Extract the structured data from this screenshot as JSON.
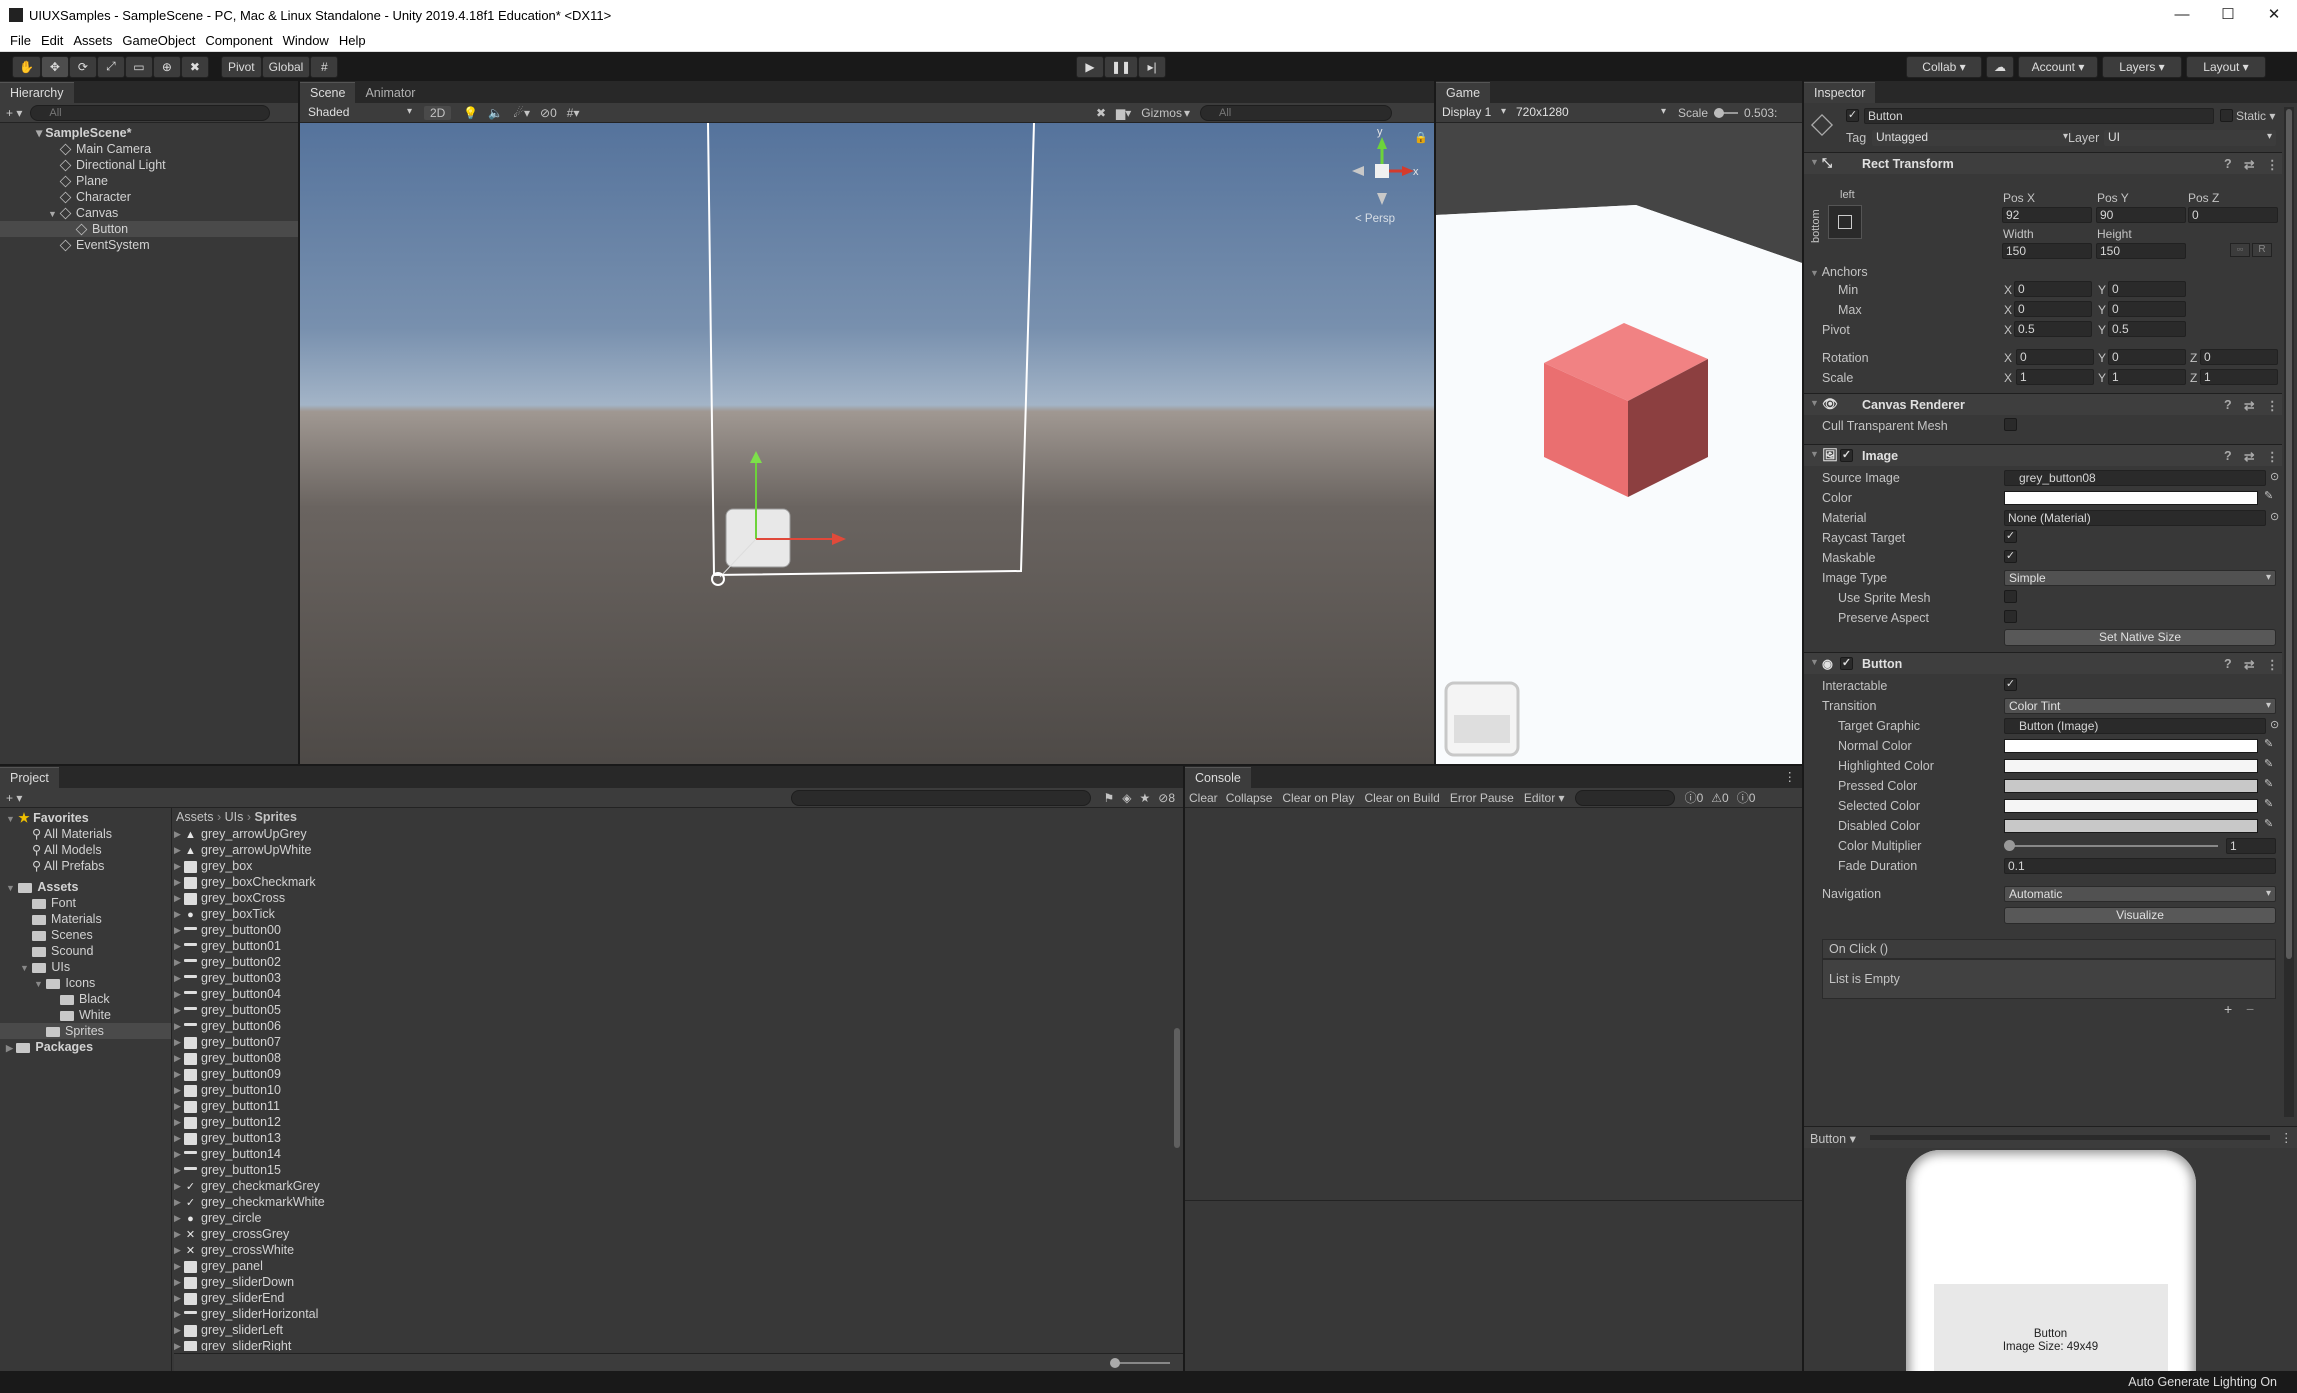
{
  "window": {
    "title": "UIUXSamples - SampleScene - PC, Mac & Linux Standalone - Unity 2019.4.18f1 Education* <DX11>"
  },
  "menu": [
    "File",
    "Edit",
    "Assets",
    "GameObject",
    "Component",
    "Window",
    "Help"
  ],
  "toolbar": {
    "pivot": "Pivot",
    "global": "Global",
    "collab": "Collab",
    "account": "Account",
    "layers": "Layers",
    "layout": "Layout"
  },
  "hierarchy": {
    "tab": "Hierarchy",
    "search_placeholder": "All",
    "items": [
      {
        "label": "SampleScene*",
        "depth": 0
      },
      {
        "label": "Main Camera",
        "depth": 1
      },
      {
        "label": "Directional Light",
        "depth": 1
      },
      {
        "label": "Plane",
        "depth": 1
      },
      {
        "label": "Character",
        "depth": 1
      },
      {
        "label": "Canvas",
        "depth": 1
      },
      {
        "label": "Button",
        "depth": 2
      },
      {
        "label": "EventSystem",
        "depth": 1
      }
    ]
  },
  "scene": {
    "tabs": [
      "Scene",
      "Animator"
    ],
    "shading": "Shaded",
    "mode2d": "2D",
    "hidden_count": "0",
    "gizmos": "Gizmos",
    "search_placeholder": "All",
    "persp": "Persp",
    "axes": {
      "y": "y",
      "x": "x"
    }
  },
  "game": {
    "tab": "Game",
    "display": "Display 1",
    "resolution": "720x1280",
    "scale_label": "Scale",
    "scale_value": "0.503:"
  },
  "inspector": {
    "tab": "Inspector",
    "object_name": "Button",
    "static_label": "Static",
    "tag_label": "Tag",
    "tag_value": "Untagged",
    "layer_label": "Layer",
    "layer_value": "UI",
    "rect": {
      "title": "Rect Transform",
      "anchor_h": "left",
      "anchor_v": "bottom",
      "posx_label": "Pos X",
      "posy_label": "Pos Y",
      "posz_label": "Pos Z",
      "posx": "92",
      "posy": "90",
      "posz": "0",
      "width_label": "Width",
      "height_label": "Height",
      "width": "150",
      "height": "150",
      "r_label": "R",
      "anchors_label": "Anchors",
      "min_label": "Min",
      "max_label": "Max",
      "pivot_label": "Pivot",
      "min_x": "0",
      "min_y": "0",
      "max_x": "0",
      "max_y": "0",
      "pivot_x": "0.5",
      "pivot_y": "0.5",
      "rotation_label": "Rotation",
      "rot_x": "0",
      "rot_y": "0",
      "rot_z": "0",
      "scale_label": "Scale",
      "scale_x": "1",
      "scale_y": "1",
      "scale_z": "1"
    },
    "canvas_renderer": {
      "title": "Canvas Renderer",
      "cull_label": "Cull Transparent Mesh"
    },
    "image": {
      "title": "Image",
      "source_label": "Source Image",
      "source_value": "grey_button08",
      "color_label": "Color",
      "material_label": "Material",
      "material_value": "None (Material)",
      "raycast_label": "Raycast Target",
      "maskable_label": "Maskable",
      "type_label": "Image Type",
      "type_value": "Simple",
      "sprite_mesh_label": "Use Sprite Mesh",
      "preserve_label": "Preserve Aspect",
      "native_btn": "Set Native Size"
    },
    "button": {
      "title": "Button",
      "interactable_label": "Interactable",
      "transition_label": "Transition",
      "transition_value": "Color Tint",
      "target_label": "Target Graphic",
      "target_value": "Button (Image)",
      "normal_label": "Normal Color",
      "highlighted_label": "Highlighted Color",
      "pressed_label": "Pressed Color",
      "selected_label": "Selected Color",
      "disabled_label": "Disabled Color",
      "multiplier_label": "Color Multiplier",
      "multiplier_value": "1",
      "fade_label": "Fade Duration",
      "fade_value": "0.1",
      "navigation_label": "Navigation",
      "navigation_value": "Automatic",
      "visualize_btn": "Visualize",
      "onclick_label": "On Click ()",
      "list_empty": "List is Empty",
      "plus": "+",
      "minus": "−"
    },
    "preview": {
      "dropdown": "Button",
      "caption1": "Button",
      "caption2": "Image Size: 49x49"
    }
  },
  "project": {
    "tab": "Project",
    "favorites_label": "Favorites",
    "favorites": [
      "All Materials",
      "All Models",
      "All Prefabs"
    ],
    "assets_label": "Assets",
    "folders": [
      {
        "label": "Font",
        "depth": 1
      },
      {
        "label": "Materials",
        "depth": 1
      },
      {
        "label": "Scenes",
        "depth": 1
      },
      {
        "label": "Scound",
        "depth": 1
      },
      {
        "label": "UIs",
        "depth": 1
      },
      {
        "label": "Icons",
        "depth": 2
      },
      {
        "label": "Black",
        "depth": 3
      },
      {
        "label": "White",
        "depth": 3
      },
      {
        "label": "Sprites",
        "depth": 2
      }
    ],
    "packages_label": "Packages",
    "breadcrumb": [
      "Assets",
      "UIs",
      "Sprites"
    ],
    "hidden_count": "8",
    "assets": [
      {
        "name": "grey_arrowUpGrey",
        "icon": "triangle"
      },
      {
        "name": "grey_arrowUpWhite",
        "icon": "triangle"
      },
      {
        "name": "grey_box",
        "icon": "box"
      },
      {
        "name": "grey_boxCheckmark",
        "icon": "box"
      },
      {
        "name": "grey_boxCross",
        "icon": "box"
      },
      {
        "name": "grey_boxTick",
        "icon": "circle"
      },
      {
        "name": "grey_button00",
        "icon": "line"
      },
      {
        "name": "grey_button01",
        "icon": "line"
      },
      {
        "name": "grey_button02",
        "icon": "line"
      },
      {
        "name": "grey_button03",
        "icon": "line"
      },
      {
        "name": "grey_button04",
        "icon": "line"
      },
      {
        "name": "grey_button05",
        "icon": "line"
      },
      {
        "name": "grey_button06",
        "icon": "line"
      },
      {
        "name": "grey_button07",
        "icon": "box"
      },
      {
        "name": "grey_button08",
        "icon": "box"
      },
      {
        "name": "grey_button09",
        "icon": "box"
      },
      {
        "name": "grey_button10",
        "icon": "box"
      },
      {
        "name": "grey_button11",
        "icon": "box"
      },
      {
        "name": "grey_button12",
        "icon": "box"
      },
      {
        "name": "grey_button13",
        "icon": "box"
      },
      {
        "name": "grey_button14",
        "icon": "line"
      },
      {
        "name": "grey_button15",
        "icon": "line"
      },
      {
        "name": "grey_checkmarkGrey",
        "icon": "check"
      },
      {
        "name": "grey_checkmarkWhite",
        "icon": "check"
      },
      {
        "name": "grey_circle",
        "icon": "circle"
      },
      {
        "name": "grey_crossGrey",
        "icon": "cross"
      },
      {
        "name": "grey_crossWhite",
        "icon": "cross"
      },
      {
        "name": "grey_panel",
        "icon": "box"
      },
      {
        "name": "grey_sliderDown",
        "icon": "box"
      },
      {
        "name": "grey_sliderEnd",
        "icon": "box"
      },
      {
        "name": "grey_sliderHorizontal",
        "icon": "line"
      },
      {
        "name": "grey_sliderLeft",
        "icon": "box"
      },
      {
        "name": "grey_sliderRight",
        "icon": "box"
      }
    ]
  },
  "console": {
    "tab": "Console",
    "buttons": [
      "Clear",
      "Collapse",
      "Clear on Play",
      "Clear on Build",
      "Error Pause",
      "Editor"
    ],
    "info_count": "0",
    "warn_count": "0",
    "error_count": "0"
  },
  "status": {
    "text": "Auto Generate Lighting On"
  }
}
